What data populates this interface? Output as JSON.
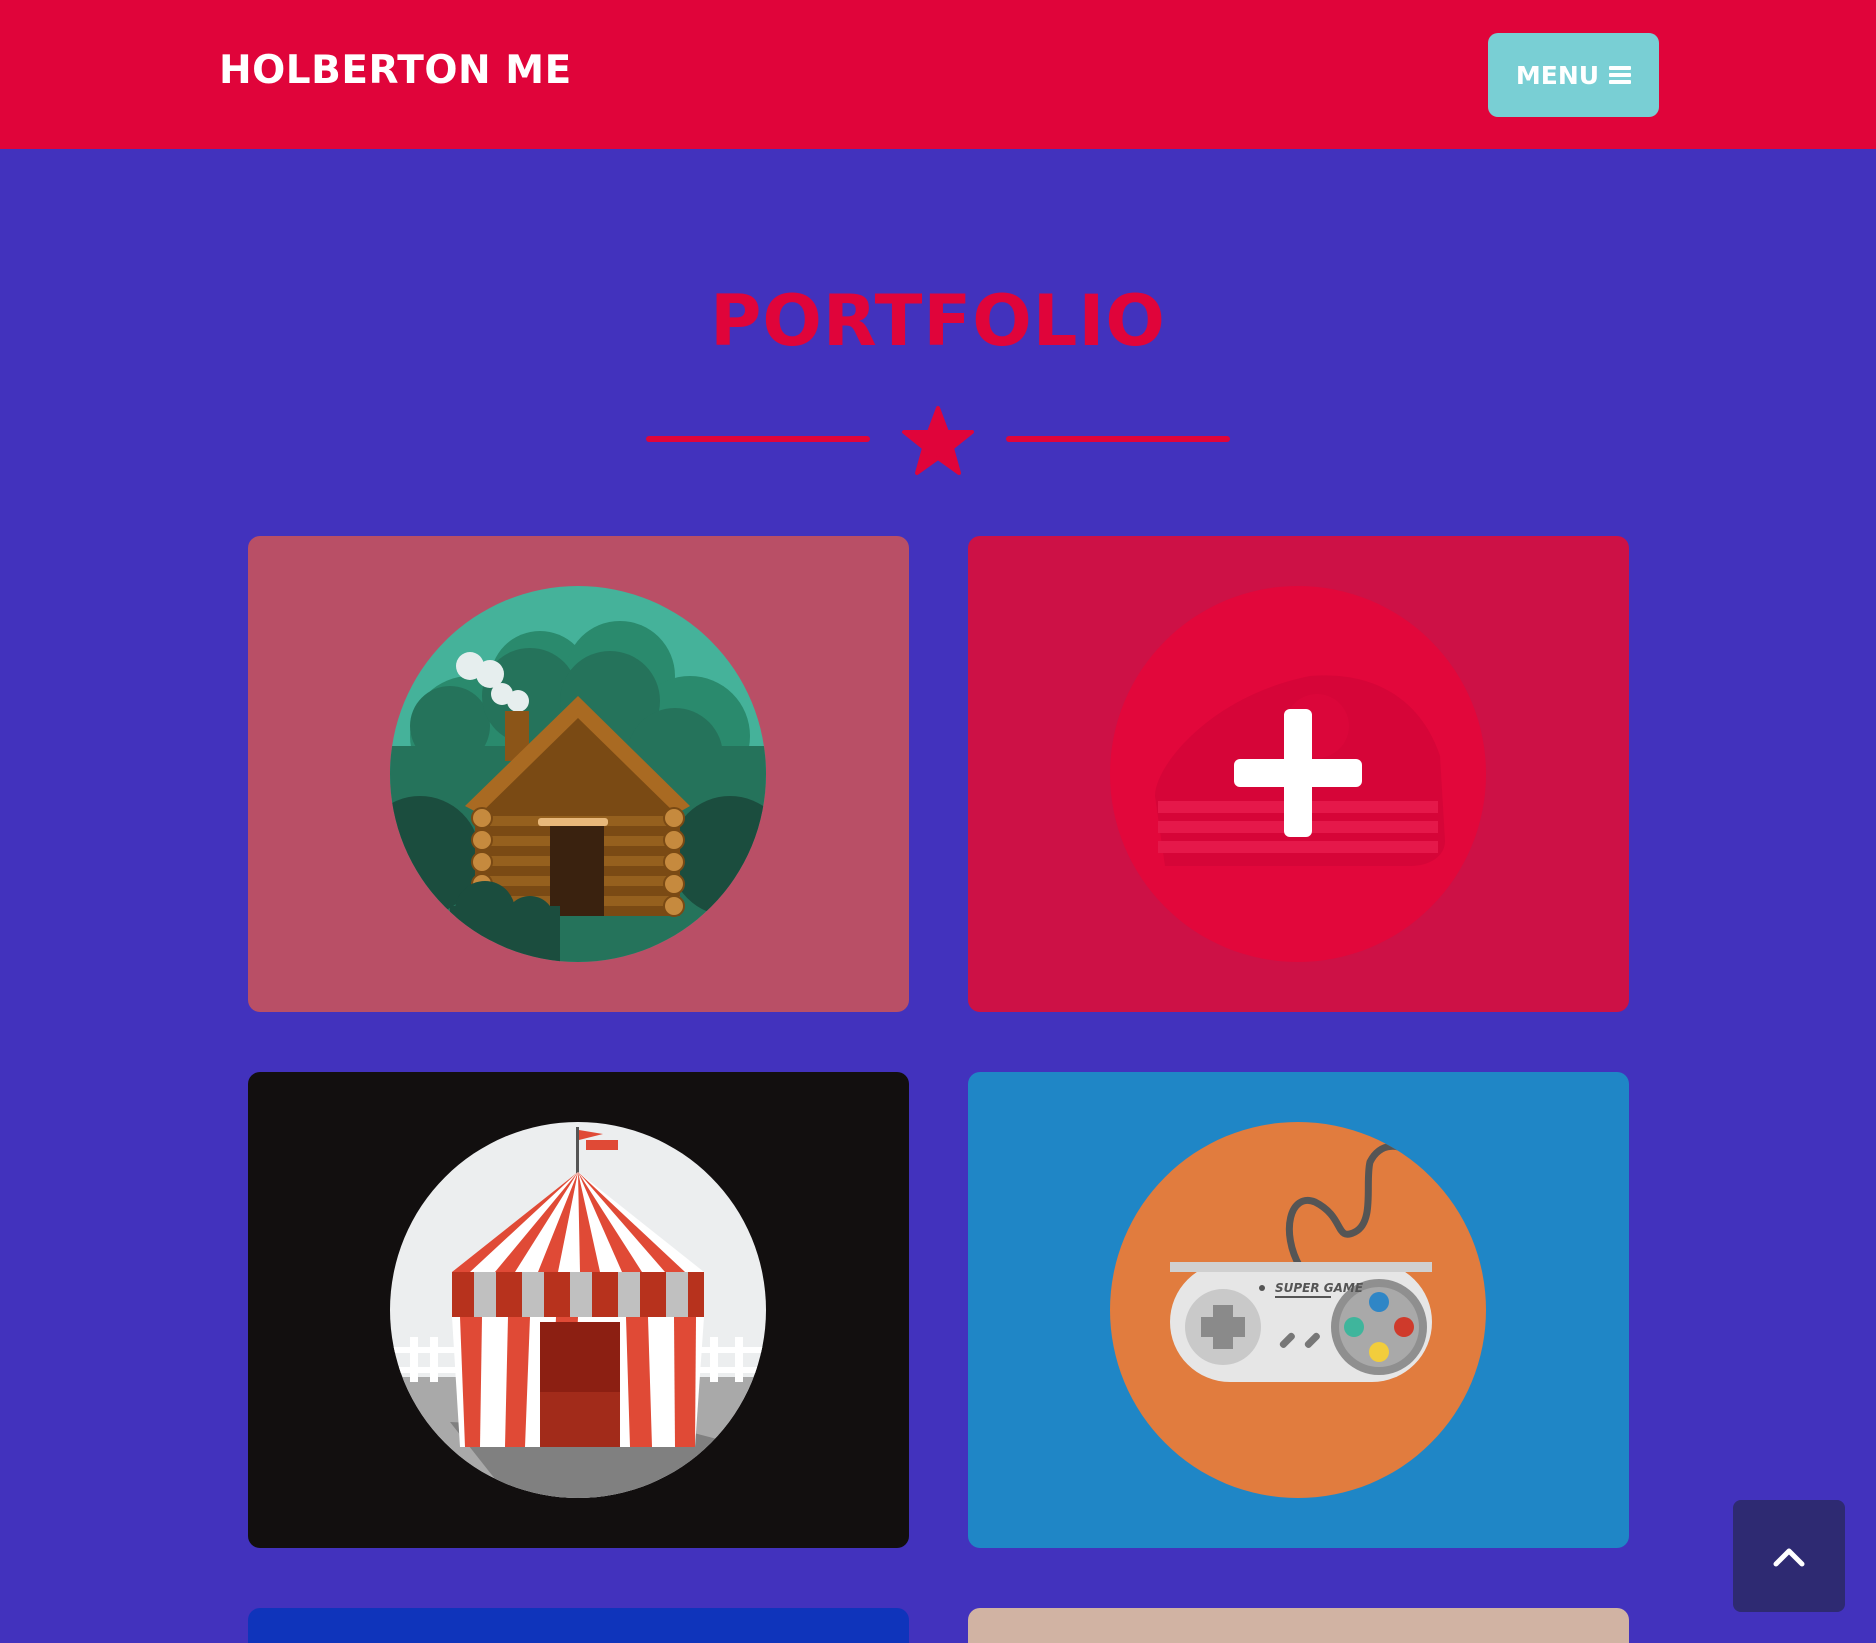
{
  "navbar": {
    "brand": "HOLBERTON ME",
    "menu_label": "MENU",
    "menu_icon": "bars-icon"
  },
  "section": {
    "title": "PORTFOLIO",
    "divider_icon": "star-icon"
  },
  "portfolio": {
    "items": [
      {
        "name": "cabin",
        "icon": "cabin-icon",
        "bg": "#b94f66"
      },
      {
        "name": "cake",
        "icon": "cake-icon",
        "bg": "#cd1146",
        "hover_icon": "plus-icon",
        "hovered": true
      },
      {
        "name": "circus",
        "icon": "circus-tent-icon",
        "bg": "#120f0f"
      },
      {
        "name": "game",
        "icon": "game-controller-icon",
        "bg": "#1f86c6",
        "controller_text": "SUPER GAME"
      },
      {
        "name": "item-5",
        "bg": "#0f34bb"
      },
      {
        "name": "item-6",
        "bg": "#d1b3a3"
      }
    ]
  },
  "scroll_top": {
    "icon": "chevron-up-icon"
  },
  "colors": {
    "primary": "#e0043a",
    "background": "#4232bd",
    "accent": "#79cfd4",
    "scroll_button": "#2e2a72"
  }
}
